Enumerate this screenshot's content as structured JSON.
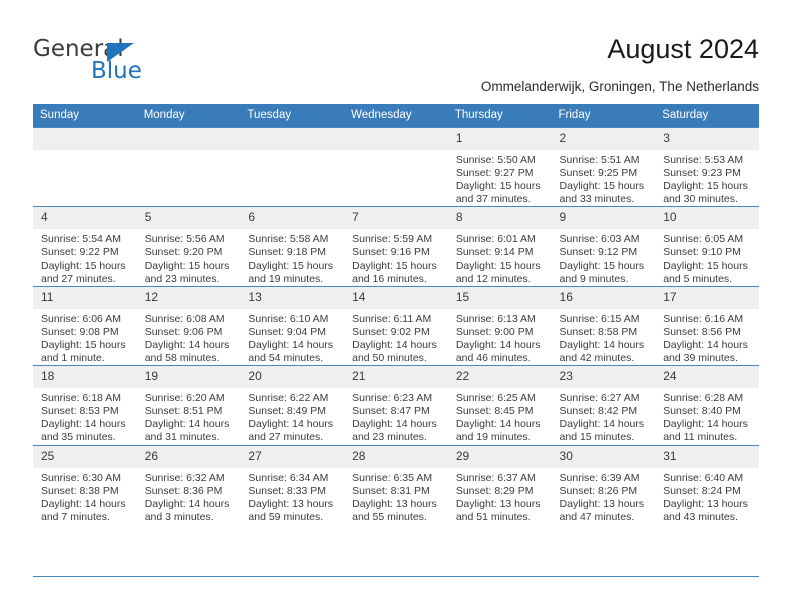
{
  "brand": {
    "name_part1": "General",
    "name_part2": "Blue",
    "triangle_color": "#1f74bd"
  },
  "header": {
    "title": "August 2024",
    "subtitle": "Ommelanderwijk, Groningen, The Netherlands"
  },
  "theme": {
    "header_row_bg": "#3a7cba",
    "header_row_text": "#ffffff",
    "daynum_bg": "#efefef",
    "row_divider": "#4a86c0"
  },
  "weekdays": [
    "Sunday",
    "Monday",
    "Tuesday",
    "Wednesday",
    "Thursday",
    "Friday",
    "Saturday"
  ],
  "weeks": [
    [
      {
        "day": "",
        "empty": true,
        "sunrise": "",
        "sunset": "",
        "daylight1": "",
        "daylight2": ""
      },
      {
        "day": "",
        "empty": true,
        "sunrise": "",
        "sunset": "",
        "daylight1": "",
        "daylight2": ""
      },
      {
        "day": "",
        "empty": true,
        "sunrise": "",
        "sunset": "",
        "daylight1": "",
        "daylight2": ""
      },
      {
        "day": "",
        "empty": true,
        "sunrise": "",
        "sunset": "",
        "daylight1": "",
        "daylight2": ""
      },
      {
        "day": "1",
        "empty": false,
        "sunrise": "Sunrise: 5:50 AM",
        "sunset": "Sunset: 9:27 PM",
        "daylight1": "Daylight: 15 hours",
        "daylight2": "and 37 minutes."
      },
      {
        "day": "2",
        "empty": false,
        "sunrise": "Sunrise: 5:51 AM",
        "sunset": "Sunset: 9:25 PM",
        "daylight1": "Daylight: 15 hours",
        "daylight2": "and 33 minutes."
      },
      {
        "day": "3",
        "empty": false,
        "sunrise": "Sunrise: 5:53 AM",
        "sunset": "Sunset: 9:23 PM",
        "daylight1": "Daylight: 15 hours",
        "daylight2": "and 30 minutes."
      }
    ],
    [
      {
        "day": "4",
        "empty": false,
        "sunrise": "Sunrise: 5:54 AM",
        "sunset": "Sunset: 9:22 PM",
        "daylight1": "Daylight: 15 hours",
        "daylight2": "and 27 minutes."
      },
      {
        "day": "5",
        "empty": false,
        "sunrise": "Sunrise: 5:56 AM",
        "sunset": "Sunset: 9:20 PM",
        "daylight1": "Daylight: 15 hours",
        "daylight2": "and 23 minutes."
      },
      {
        "day": "6",
        "empty": false,
        "sunrise": "Sunrise: 5:58 AM",
        "sunset": "Sunset: 9:18 PM",
        "daylight1": "Daylight: 15 hours",
        "daylight2": "and 19 minutes."
      },
      {
        "day": "7",
        "empty": false,
        "sunrise": "Sunrise: 5:59 AM",
        "sunset": "Sunset: 9:16 PM",
        "daylight1": "Daylight: 15 hours",
        "daylight2": "and 16 minutes."
      },
      {
        "day": "8",
        "empty": false,
        "sunrise": "Sunrise: 6:01 AM",
        "sunset": "Sunset: 9:14 PM",
        "daylight1": "Daylight: 15 hours",
        "daylight2": "and 12 minutes."
      },
      {
        "day": "9",
        "empty": false,
        "sunrise": "Sunrise: 6:03 AM",
        "sunset": "Sunset: 9:12 PM",
        "daylight1": "Daylight: 15 hours",
        "daylight2": "and 9 minutes."
      },
      {
        "day": "10",
        "empty": false,
        "sunrise": "Sunrise: 6:05 AM",
        "sunset": "Sunset: 9:10 PM",
        "daylight1": "Daylight: 15 hours",
        "daylight2": "and 5 minutes."
      }
    ],
    [
      {
        "day": "11",
        "empty": false,
        "sunrise": "Sunrise: 6:06 AM",
        "sunset": "Sunset: 9:08 PM",
        "daylight1": "Daylight: 15 hours",
        "daylight2": "and 1 minute."
      },
      {
        "day": "12",
        "empty": false,
        "sunrise": "Sunrise: 6:08 AM",
        "sunset": "Sunset: 9:06 PM",
        "daylight1": "Daylight: 14 hours",
        "daylight2": "and 58 minutes."
      },
      {
        "day": "13",
        "empty": false,
        "sunrise": "Sunrise: 6:10 AM",
        "sunset": "Sunset: 9:04 PM",
        "daylight1": "Daylight: 14 hours",
        "daylight2": "and 54 minutes."
      },
      {
        "day": "14",
        "empty": false,
        "sunrise": "Sunrise: 6:11 AM",
        "sunset": "Sunset: 9:02 PM",
        "daylight1": "Daylight: 14 hours",
        "daylight2": "and 50 minutes."
      },
      {
        "day": "15",
        "empty": false,
        "sunrise": "Sunrise: 6:13 AM",
        "sunset": "Sunset: 9:00 PM",
        "daylight1": "Daylight: 14 hours",
        "daylight2": "and 46 minutes."
      },
      {
        "day": "16",
        "empty": false,
        "sunrise": "Sunrise: 6:15 AM",
        "sunset": "Sunset: 8:58 PM",
        "daylight1": "Daylight: 14 hours",
        "daylight2": "and 42 minutes."
      },
      {
        "day": "17",
        "empty": false,
        "sunrise": "Sunrise: 6:16 AM",
        "sunset": "Sunset: 8:56 PM",
        "daylight1": "Daylight: 14 hours",
        "daylight2": "and 39 minutes."
      }
    ],
    [
      {
        "day": "18",
        "empty": false,
        "sunrise": "Sunrise: 6:18 AM",
        "sunset": "Sunset: 8:53 PM",
        "daylight1": "Daylight: 14 hours",
        "daylight2": "and 35 minutes."
      },
      {
        "day": "19",
        "empty": false,
        "sunrise": "Sunrise: 6:20 AM",
        "sunset": "Sunset: 8:51 PM",
        "daylight1": "Daylight: 14 hours",
        "daylight2": "and 31 minutes."
      },
      {
        "day": "20",
        "empty": false,
        "sunrise": "Sunrise: 6:22 AM",
        "sunset": "Sunset: 8:49 PM",
        "daylight1": "Daylight: 14 hours",
        "daylight2": "and 27 minutes."
      },
      {
        "day": "21",
        "empty": false,
        "sunrise": "Sunrise: 6:23 AM",
        "sunset": "Sunset: 8:47 PM",
        "daylight1": "Daylight: 14 hours",
        "daylight2": "and 23 minutes."
      },
      {
        "day": "22",
        "empty": false,
        "sunrise": "Sunrise: 6:25 AM",
        "sunset": "Sunset: 8:45 PM",
        "daylight1": "Daylight: 14 hours",
        "daylight2": "and 19 minutes."
      },
      {
        "day": "23",
        "empty": false,
        "sunrise": "Sunrise: 6:27 AM",
        "sunset": "Sunset: 8:42 PM",
        "daylight1": "Daylight: 14 hours",
        "daylight2": "and 15 minutes."
      },
      {
        "day": "24",
        "empty": false,
        "sunrise": "Sunrise: 6:28 AM",
        "sunset": "Sunset: 8:40 PM",
        "daylight1": "Daylight: 14 hours",
        "daylight2": "and 11 minutes."
      }
    ],
    [
      {
        "day": "25",
        "empty": false,
        "sunrise": "Sunrise: 6:30 AM",
        "sunset": "Sunset: 8:38 PM",
        "daylight1": "Daylight: 14 hours",
        "daylight2": "and 7 minutes."
      },
      {
        "day": "26",
        "empty": false,
        "sunrise": "Sunrise: 6:32 AM",
        "sunset": "Sunset: 8:36 PM",
        "daylight1": "Daylight: 14 hours",
        "daylight2": "and 3 minutes."
      },
      {
        "day": "27",
        "empty": false,
        "sunrise": "Sunrise: 6:34 AM",
        "sunset": "Sunset: 8:33 PM",
        "daylight1": "Daylight: 13 hours",
        "daylight2": "and 59 minutes."
      },
      {
        "day": "28",
        "empty": false,
        "sunrise": "Sunrise: 6:35 AM",
        "sunset": "Sunset: 8:31 PM",
        "daylight1": "Daylight: 13 hours",
        "daylight2": "and 55 minutes."
      },
      {
        "day": "29",
        "empty": false,
        "sunrise": "Sunrise: 6:37 AM",
        "sunset": "Sunset: 8:29 PM",
        "daylight1": "Daylight: 13 hours",
        "daylight2": "and 51 minutes."
      },
      {
        "day": "30",
        "empty": false,
        "sunrise": "Sunrise: 6:39 AM",
        "sunset": "Sunset: 8:26 PM",
        "daylight1": "Daylight: 13 hours",
        "daylight2": "and 47 minutes."
      },
      {
        "day": "31",
        "empty": false,
        "sunrise": "Sunrise: 6:40 AM",
        "sunset": "Sunset: 8:24 PM",
        "daylight1": "Daylight: 13 hours",
        "daylight2": "and 43 minutes."
      }
    ]
  ]
}
